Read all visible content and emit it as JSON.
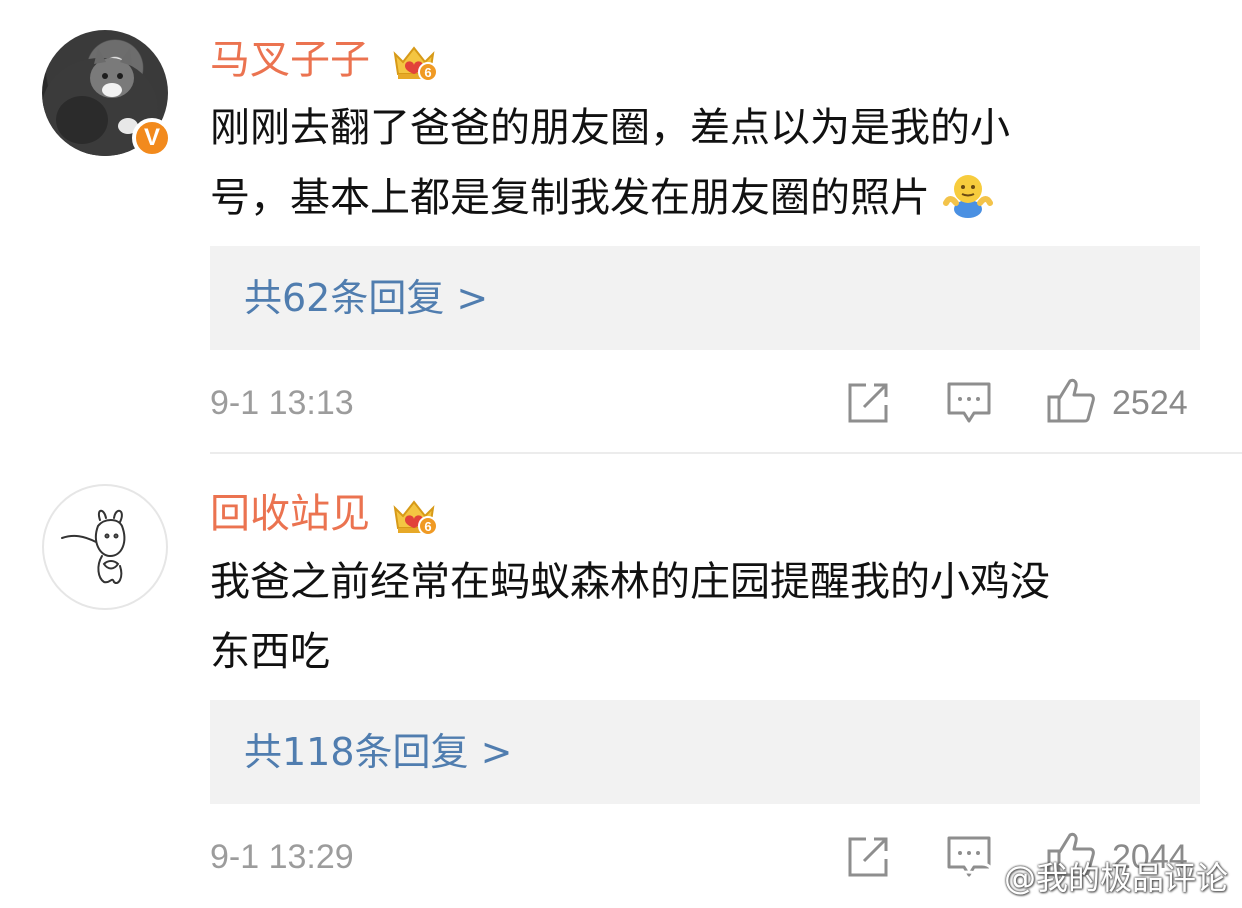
{
  "comments": [
    {
      "username": "马叉子子",
      "badge_level": "6",
      "verified_mark": "V",
      "text_lines": [
        "刚刚去翻了爸爸的朋友圈，差点以为是我的小",
        "号，基本上都是复制我发在朋友圈的照片"
      ],
      "trailing_emoji": "shrug-emoji",
      "replies_label": "共62条回复 >",
      "timestamp": "9-1 13:13",
      "likes": "2524"
    },
    {
      "username": "回收站见",
      "badge_level": "6",
      "text_lines": [
        "我爸之前经常在蚂蚁森林的庄园提醒我的小鸡没",
        "东西吃"
      ],
      "replies_label": "共118条回复 >",
      "timestamp": "9-1 13:29",
      "likes": "2044"
    }
  ],
  "watermark": "@我的极品评论",
  "icons": {
    "repost": "repost-icon",
    "comment": "comment-icon",
    "like": "thumbs-up-icon",
    "crown": "crown-badge-icon"
  },
  "colors": {
    "username": "#eb7350",
    "reply_link": "#507daf",
    "reply_box": "#f2f2f2",
    "meta_text": "#9c9c9c",
    "verified_badge": "#f28a1d"
  }
}
